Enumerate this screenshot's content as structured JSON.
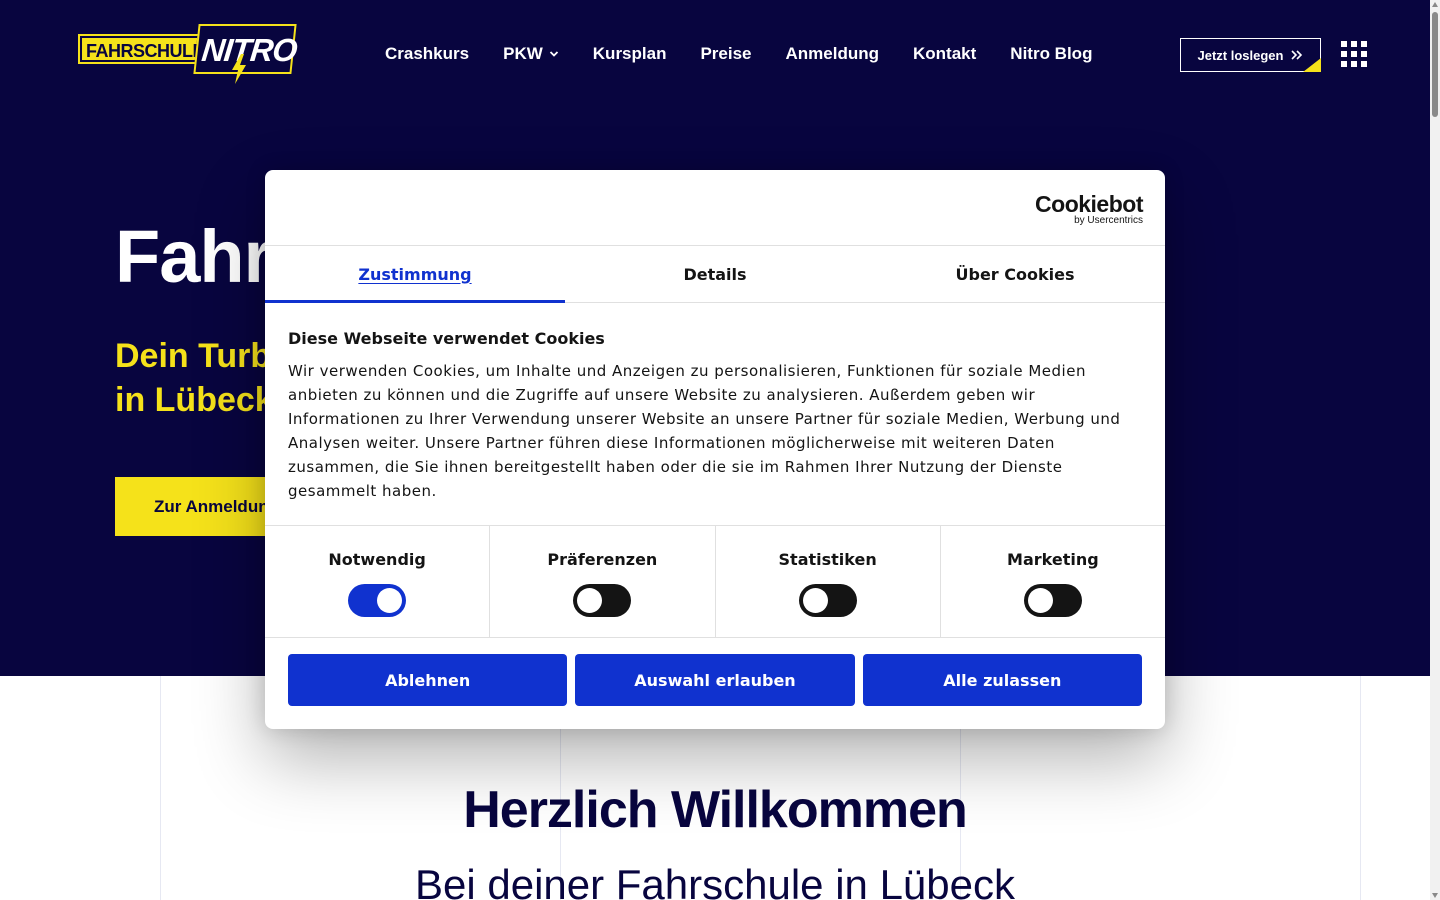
{
  "header": {
    "logo_left_text": "FAHRSCHULE",
    "logo_right_text": "NITRO",
    "nav": [
      {
        "label": "Crashkurs"
      },
      {
        "label": "PKW",
        "has_dropdown": true
      },
      {
        "label": "Kursplan"
      },
      {
        "label": "Preise"
      },
      {
        "label": "Anmeldung"
      },
      {
        "label": "Kontakt"
      },
      {
        "label": "Nitro Blog"
      }
    ],
    "cta_label": "Jetzt loslegen",
    "cta_icon": "double-chevron-right-icon",
    "menu_icon": "grid-menu-icon"
  },
  "hero": {
    "title": "Fahr",
    "subtitle_line1": "Dein Turb",
    "subtitle_line2": "in Lübeck",
    "button_label": "Zur Anmeldun"
  },
  "welcome": {
    "title": "Herzlich Willkommen",
    "subtitle": "Bei deiner Fahrschule in Lübeck"
  },
  "cookie_dialog": {
    "brand_name": "Cookiebot",
    "brand_by": "by Usercentrics",
    "tabs": [
      {
        "label": "Zustimmung",
        "active": true
      },
      {
        "label": "Details",
        "active": false
      },
      {
        "label": "Über Cookies",
        "active": false
      }
    ],
    "heading": "Diese Webseite verwendet Cookies",
    "text": "Wir verwenden Cookies, um Inhalte und Anzeigen zu personalisieren, Funktionen für soziale Medien anbieten zu können und die Zugriffe auf unsere Website zu analysieren. Außerdem geben wir Informationen zu Ihrer Verwendung unserer Website an unsere Partner für soziale Medien, Werbung und Analysen weiter. Unsere Partner führen diese Informationen möglicherweise mit weiteren Daten zusammen, die Sie ihnen bereitgestellt haben oder die sie im Rahmen Ihrer Nutzung der Dienste gesammelt haben.",
    "toggles": [
      {
        "label": "Notwendig",
        "on": true
      },
      {
        "label": "Präferenzen",
        "on": false
      },
      {
        "label": "Statistiken",
        "on": false
      },
      {
        "label": "Marketing",
        "on": false
      }
    ],
    "buttons": {
      "decline": "Ablehnen",
      "allow_selection": "Auswahl erlauben",
      "allow_all": "Alle zulassen"
    }
  },
  "colors": {
    "navy": "#08053f",
    "yellow": "#f5e21a",
    "cookiebot_blue": "#1032cf"
  }
}
